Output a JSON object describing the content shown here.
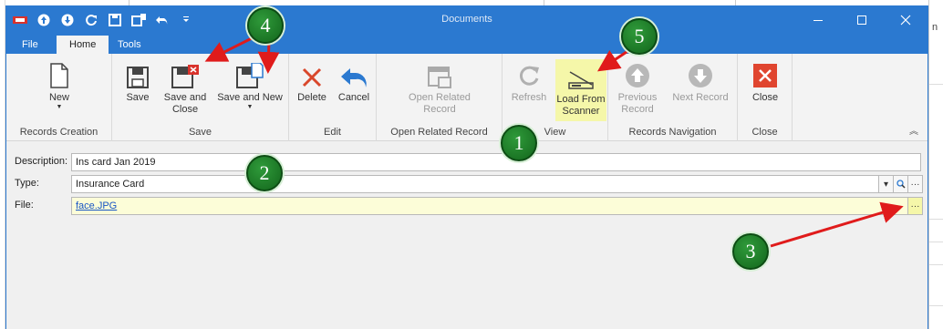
{
  "window": {
    "title": "Documents"
  },
  "tabs": [
    {
      "label": "File"
    },
    {
      "label": "Home"
    },
    {
      "label": "Tools"
    }
  ],
  "ribbon": {
    "groups": {
      "records_creation": "Records Creation",
      "save": "Save",
      "edit": "Edit",
      "open_related": "Open Related Record",
      "view": "View",
      "records_navigation": "Records Navigation",
      "close": "Close"
    },
    "buttons": {
      "new": "New",
      "save": "Save",
      "save_and_close_1": "Save and",
      "save_and_close_2": "Close",
      "save_and_new": "Save and New",
      "delete": "Delete",
      "cancel": "Cancel",
      "open_related_1": "Open Related",
      "open_related_2": "Record",
      "refresh": "Refresh",
      "load_scanner_1": "Load From",
      "load_scanner_2": "Scanner",
      "previous_1": "Previous",
      "previous_2": "Record",
      "next": "Next Record",
      "close": "Close"
    }
  },
  "form": {
    "description_label": "Description:",
    "description_value": "Ins card Jan 2019",
    "type_label": "Type:",
    "type_value": "Insurance Card",
    "file_label": "File:",
    "file_value": "face.JPG",
    "ellipsis": "···"
  },
  "annotations": [
    "1",
    "2",
    "3",
    "4",
    "5"
  ],
  "background": {
    "right_fragment": "n"
  },
  "colors": {
    "titlebar": "#2b79d0",
    "highlight": "#f5f7a9",
    "badge": "#1e7d28",
    "arrow": "#e01b1b"
  },
  "icons": [
    "app-logo-icon",
    "up-arrow-icon",
    "down-arrow-icon",
    "refresh-icon",
    "save-icon",
    "save-new-icon",
    "undo-icon",
    "customize-icon",
    "minimize-icon",
    "maximize-icon",
    "close-icon",
    "new-document-icon",
    "save-close-icon",
    "delete-icon",
    "cancel-icon",
    "open-related-icon",
    "scanner-icon",
    "previous-icon",
    "next-icon",
    "close-window-icon"
  ]
}
